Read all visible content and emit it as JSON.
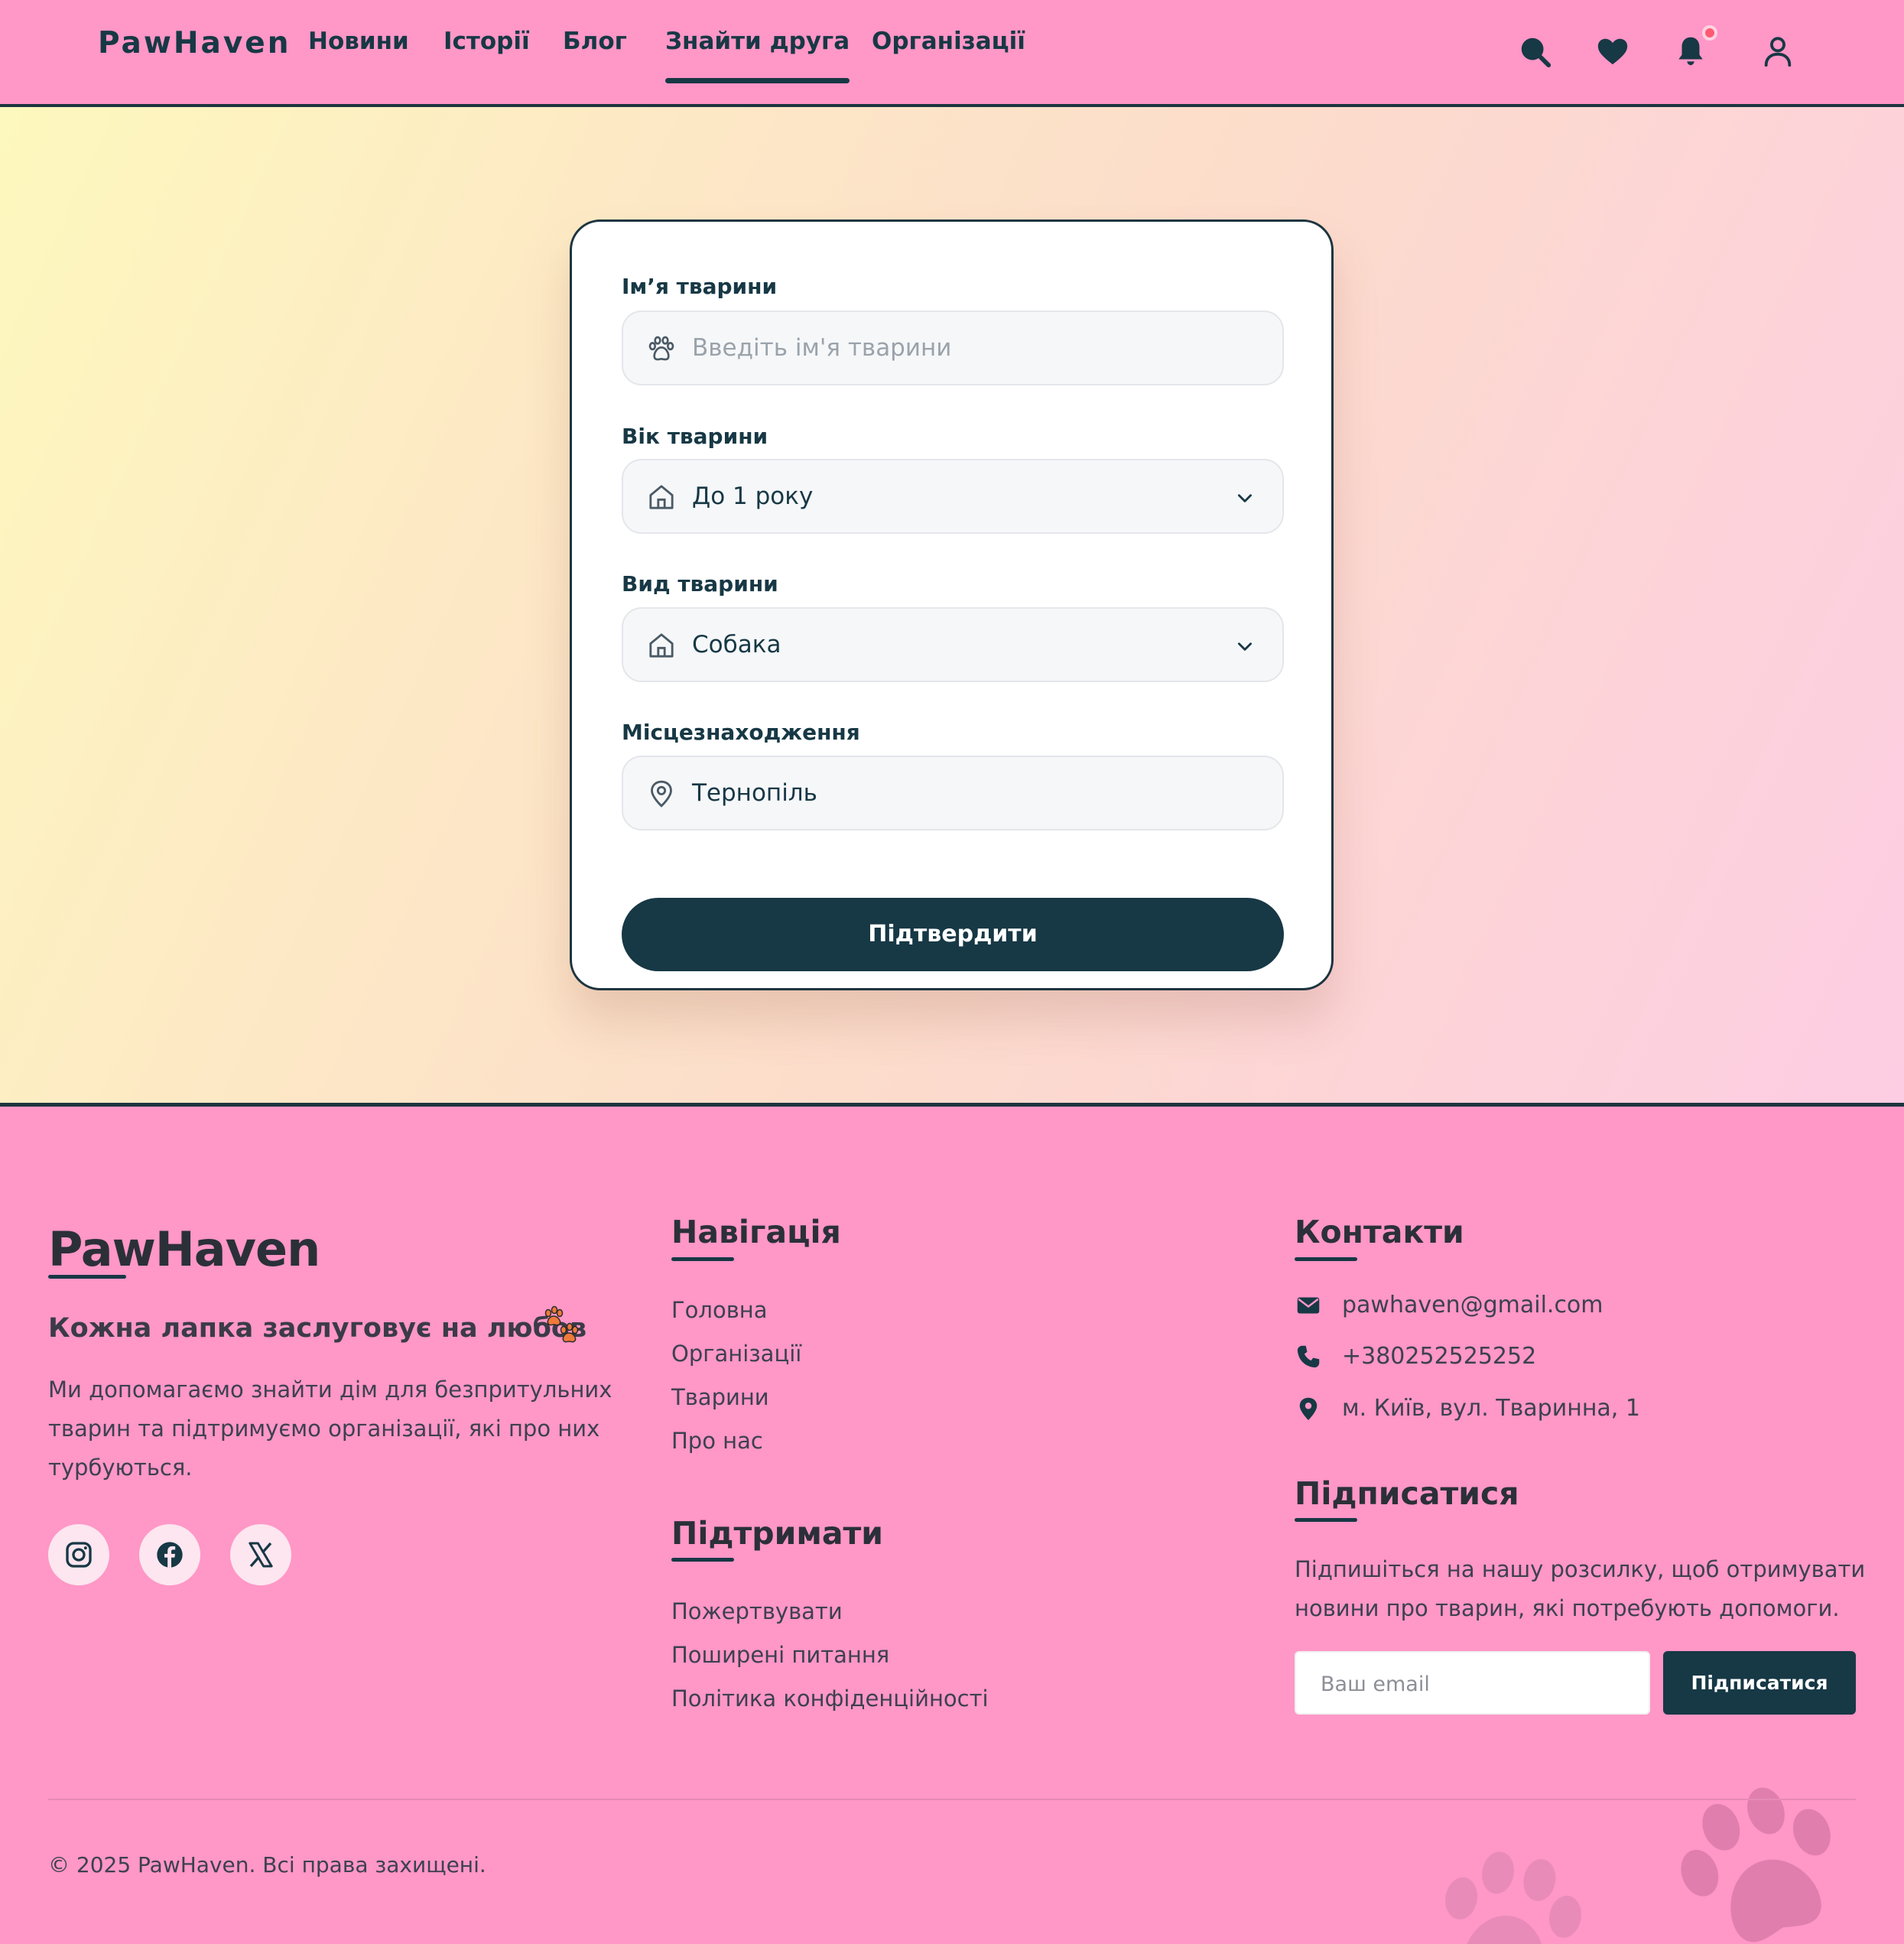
{
  "header": {
    "logo": "PawHaven",
    "nav": [
      {
        "label": "Новини",
        "active": false
      },
      {
        "label": "Історії",
        "active": false
      },
      {
        "label": "Блог",
        "active": false
      },
      {
        "label": "Знайти друга",
        "active": true
      },
      {
        "label": "Організації",
        "active": false
      }
    ],
    "icons": [
      "search-icon",
      "heart-icon",
      "bell-icon",
      "user-icon"
    ],
    "notification_badge_color": "#ff5a72"
  },
  "form": {
    "name_label": "Ім’я тварини",
    "name_placeholder": "Введіть ім'я тварини",
    "age_label": "Вік тварини",
    "age_value": "До 1 року",
    "type_label": "Вид тварини",
    "type_value": "Собака",
    "location_label": "Місцезнаходження",
    "location_value": "Тернопіль",
    "submit_label": "Підтвердити"
  },
  "footer": {
    "logo": "PawHaven",
    "tagline": "Кожна лапка заслуговує на любов",
    "description": "Ми допомагаємо знайти дім для безпритульних тварин та підтримуємо організації, які про них турбуються.",
    "social": [
      "instagram-icon",
      "facebook-icon",
      "x-icon"
    ],
    "navigation": {
      "title": "Навігація",
      "links": [
        "Головна",
        "Організації",
        "Тварини",
        "Про нас"
      ]
    },
    "support": {
      "title": "Підтримати",
      "links": [
        "Пожертвувати",
        "Поширені питання",
        "Політика конфіденційності"
      ]
    },
    "contacts": {
      "title": "Контакти",
      "email": "pawhaven@gmail.com",
      "phone": "+380252525252",
      "address": "м. Київ, вул. Тваринна, 1"
    },
    "subscribe": {
      "title": "Підписатися",
      "description": "Підпишіться на нашу розсилку, щоб отримувати новини про тварин, які потребують допомоги.",
      "email_placeholder": "Ваш email",
      "button_label": "Підписатися"
    },
    "copyright": "© 2025 PawHaven. Всі права захищені."
  },
  "colors": {
    "brand_pink": "#ff97c7",
    "primary_dark": "#173845"
  }
}
